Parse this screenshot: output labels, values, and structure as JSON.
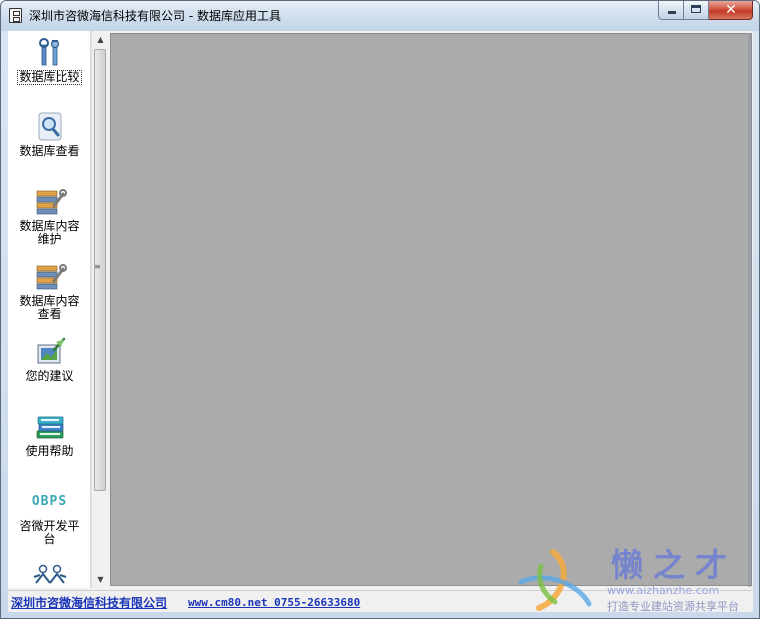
{
  "window": {
    "title": "深圳市咨微海信科技有限公司 - 数据库应用工具",
    "close_glyph": "✕"
  },
  "sidebar": {
    "items": [
      {
        "label": "数据库比较",
        "icon": "tools-icon",
        "selected": true
      },
      {
        "label": "数据库查看",
        "icon": "magnifier-icon",
        "selected": false
      },
      {
        "label": "数据库内容维护",
        "icon": "database-edit-icon",
        "selected": false
      },
      {
        "label": "数据库内容查看",
        "icon": "database-view-icon",
        "selected": false
      },
      {
        "label": "您的建议",
        "icon": "feedback-icon",
        "selected": false
      },
      {
        "label": "使用帮助",
        "icon": "books-icon",
        "selected": false
      },
      {
        "label": "咨微开发平台",
        "icon": "obps-logo-icon",
        "icon_text": "OBPS",
        "selected": false
      },
      {
        "label": "",
        "icon": "people-icon",
        "selected": false
      }
    ],
    "scroll_up": "▲",
    "scroll_down": "▼",
    "splitter_grip": "≡"
  },
  "statusbar": {
    "company": "深圳市咨微海信科技有限公司",
    "contact": "www.cm80.net 0755-26633680"
  },
  "watermark": {
    "title": "懒之才",
    "url": "www.aizhanzhe.com",
    "slogan": "打造专业建站资源共享平台"
  },
  "colors": {
    "mdi_background": "#ababab",
    "status_link": "#1a35b8",
    "watermark": "#6a7bd6"
  }
}
